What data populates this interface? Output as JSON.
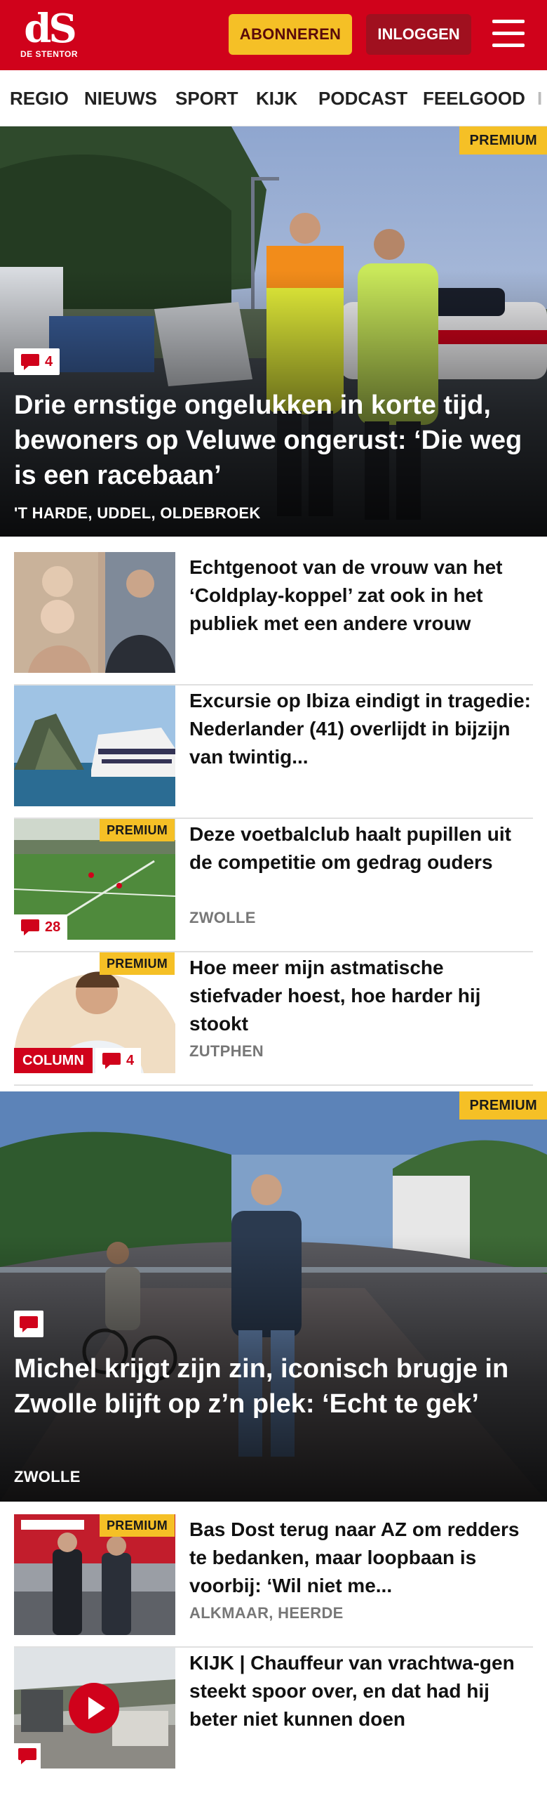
{
  "header": {
    "logo_mark": "dS",
    "logo_name": "DE STENTOR",
    "subscribe_label": "ABONNEREN",
    "login_label": "INLOGGEN",
    "brand_color": "#d0021b",
    "accent_color": "#f5c026"
  },
  "nav": {
    "items": [
      "REGIO",
      "NIEUWS",
      "SPORT",
      "KIJK",
      "PODCAST",
      "FEELGOOD",
      "I"
    ]
  },
  "hero1": {
    "premium": "PREMIUM",
    "comments": "4",
    "title": "Drie ernstige ongelukken in korte tijd, bewoners op Veluwe ongerust: ‘Die weg is een racebaan’",
    "location": "'T HARDE, UDDEL, OLDEBROEK"
  },
  "articles": [
    {
      "title": "Echtgenoot van de vrouw van het ‘Coldplay-koppel’ zat ook in het publiek met een andere vrouw"
    },
    {
      "title": "Excursie op Ibiza eindigt in tragedie: Nederlander (41) overlijdt in bijzijn van twintig..."
    },
    {
      "premium": "PREMIUM",
      "comments": "28",
      "title": "Deze voetbalclub haalt pupillen uit de competitie om gedrag ouders",
      "location": "ZWOLLE"
    },
    {
      "premium": "PREMIUM",
      "column": "COLUMN",
      "comments": "4",
      "title": "Hoe meer mijn astmatische stiefvader hoest, hoe harder hij stookt",
      "location": "ZUTPHEN"
    }
  ],
  "hero2": {
    "premium": "PREMIUM",
    "title": "Michel krijgt zijn zin, iconisch brugje in Zwolle blijft op z’n plek: ‘Echt te gek’",
    "location": "ZWOLLE"
  },
  "articles2": [
    {
      "premium": "PREMIUM",
      "title": "Bas Dost terug naar AZ om redders te bedanken, maar loopbaan is voorbij: ‘Wil niet me...",
      "location": "ALKMAAR, HEERDE"
    },
    {
      "title": "KIJK | Chauffeur van vrachtwa-gen steekt spoor over, en dat had hij beter niet kunnen doen"
    }
  ]
}
